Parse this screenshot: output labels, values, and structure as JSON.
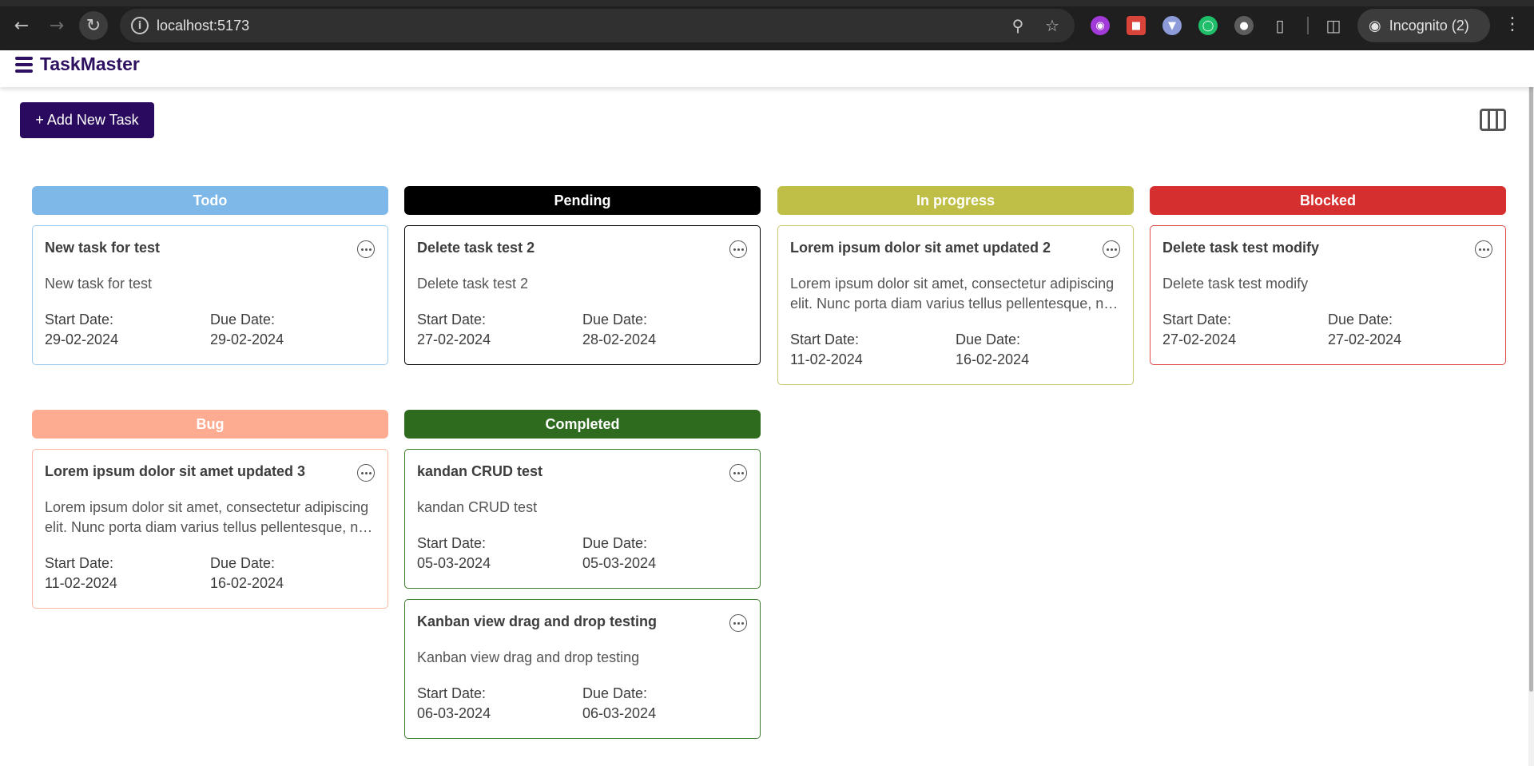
{
  "browser": {
    "url": "localhost:5173",
    "incognito_label": "Incognito (2)",
    "icons": [
      "back-icon",
      "forward-icon",
      "reload-icon",
      "info-icon",
      "zoom-icon",
      "star-icon",
      "extensions-icon",
      "side-panel-icon",
      "incognito-icon",
      "menu-icon"
    ]
  },
  "app": {
    "title": "TaskMaster",
    "add_button_label": "+ Add New Task"
  },
  "columns": [
    {
      "id": "todo",
      "title": "Todo",
      "header_color": "#7db8e8",
      "border_color": "#9ccaee",
      "tasks": [
        {
          "title": "New task for test",
          "description": "New task for test",
          "start_label": "Start Date:",
          "start_date": "29-02-2024",
          "due_label": "Due Date:",
          "due_date": "29-02-2024"
        }
      ]
    },
    {
      "id": "pending",
      "title": "Pending",
      "header_color": "#000000",
      "border_color": "#000000",
      "tasks": [
        {
          "title": "Delete task test 2",
          "description": "Delete task test 2",
          "start_label": "Start Date:",
          "start_date": "27-02-2024",
          "due_label": "Due Date:",
          "due_date": "28-02-2024"
        }
      ]
    },
    {
      "id": "in-progress",
      "title": "In progress",
      "header_color": "#bfbe46",
      "border_color": "#c9c86a",
      "tasks": [
        {
          "title": "Lorem ipsum dolor sit amet updated 2",
          "description": "Lorem ipsum dolor sit amet, consectetur adipiscing elit. Nunc porta diam varius tellus pellentesque, nec aliquet massa posuere.",
          "start_label": "Start Date:",
          "start_date": "11-02-2024",
          "due_label": "Due Date:",
          "due_date": "16-02-2024"
        }
      ]
    },
    {
      "id": "blocked",
      "title": "Blocked",
      "header_color": "#d62f2f",
      "border_color": "#e04848",
      "tasks": [
        {
          "title": "Delete task test modify",
          "description": "Delete task test modify",
          "start_label": "Start Date:",
          "start_date": "27-02-2024",
          "due_label": "Due Date:",
          "due_date": "27-02-2024"
        }
      ]
    },
    {
      "id": "bug",
      "title": "Bug",
      "header_color": "#fdab91",
      "border_color": "#fdb9a3",
      "tasks": [
        {
          "title": "Lorem ipsum dolor sit amet updated 3",
          "description": "Lorem ipsum dolor sit amet, consectetur adipiscing elit. Nunc porta diam varius tellus pellentesque, nec aliquet massa posuere.",
          "start_label": "Start Date:",
          "start_date": "11-02-2024",
          "due_label": "Due Date:",
          "due_date": "16-02-2024"
        }
      ]
    },
    {
      "id": "completed",
      "title": "Completed",
      "header_color": "#2e6b1f",
      "border_color": "#3d7d2c",
      "tasks": [
        {
          "title": "kandan CRUD test",
          "description": "kandan CRUD test",
          "start_label": "Start Date:",
          "start_date": "05-03-2024",
          "due_label": "Due Date:",
          "due_date": "05-03-2024"
        },
        {
          "title": "Kanban view drag and drop testing",
          "description": "Kanban view drag and drop testing",
          "start_label": "Start Date:",
          "start_date": "06-03-2024",
          "due_label": "Due Date:",
          "due_date": "06-03-2024"
        }
      ]
    }
  ]
}
